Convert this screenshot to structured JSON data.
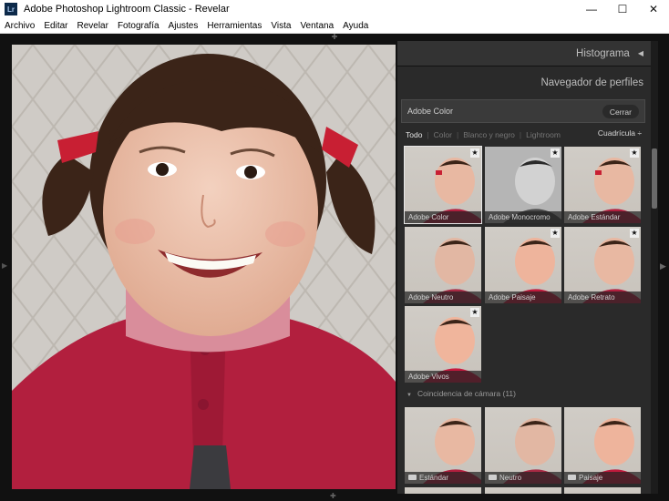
{
  "window": {
    "title": "Adobe Photoshop Lightroom Classic - Revelar",
    "app_icon": "Lr",
    "controls": {
      "minimize": "—",
      "maximize": "☐",
      "close": "✕"
    }
  },
  "menu": [
    {
      "label": "Archivo"
    },
    {
      "label": "Editar"
    },
    {
      "label": "Revelar"
    },
    {
      "label": "Fotografía"
    },
    {
      "label": "Ajustes"
    },
    {
      "label": "Herramientas"
    },
    {
      "label": "Vista"
    },
    {
      "label": "Ventana"
    },
    {
      "label": "Ayuda"
    }
  ],
  "panel": {
    "histogram": "Histograma",
    "browser_title": "Navegador de perfiles",
    "current_profile": "Adobe Color",
    "close_label": "Cerrar",
    "filters": [
      "Todo",
      "Color",
      "Blanco y negro",
      "Lightroom"
    ],
    "view_mode": "Cuadrícula ÷",
    "profiles": [
      {
        "name": "Adobe Color"
      },
      {
        "name": "Adobe Monocromo"
      },
      {
        "name": "Adobe Estándar"
      },
      {
        "name": "Adobe Neutro"
      },
      {
        "name": "Adobe Paisaje"
      },
      {
        "name": "Adobe Retrato"
      },
      {
        "name": "Adobe Vivos"
      }
    ],
    "camera_section": "Coincidencia de cámara (11)",
    "camera_profiles": [
      {
        "name": "Estándar"
      },
      {
        "name": "Neutro"
      },
      {
        "name": "Paisaje"
      }
    ]
  },
  "icons": {
    "star": "★",
    "collapse": "◀",
    "expand_section": "▼",
    "panel_right": "▶",
    "grip": "✚"
  }
}
